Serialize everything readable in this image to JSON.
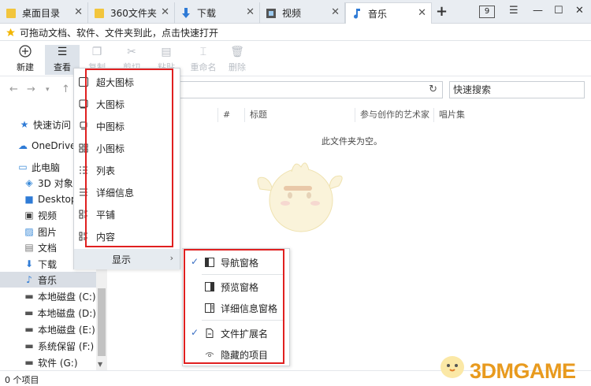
{
  "tabs": [
    {
      "label": "桌面目录",
      "icon": "folder-icon",
      "active": false
    },
    {
      "label": "360文件夹",
      "icon": "folder-icon",
      "active": false
    },
    {
      "label": "下载",
      "icon": "download-arrow-icon",
      "active": false
    },
    {
      "label": "视频",
      "icon": "video-icon",
      "active": false
    },
    {
      "label": "音乐",
      "icon": "music-note-icon",
      "active": true
    }
  ],
  "tab_count": "9",
  "hint": {
    "text": "可拖动文档、软件、文件夹到此，点击快速打开",
    "icon": "star-icon"
  },
  "toolbar": {
    "new_label": "新建",
    "view_label": "查看",
    "copy_label": "复制",
    "cut_label": "剪切",
    "paste_label": "粘贴",
    "rename_label": "重命名",
    "delete_label": "删除"
  },
  "search": {
    "placeholder": "快速搜索"
  },
  "sidebar": {
    "items": [
      {
        "label": "快速访问",
        "icon": "star-icon"
      },
      {
        "label": "OneDrive",
        "icon": "cloud-icon"
      },
      {
        "label": "此电脑",
        "icon": "computer-icon"
      },
      {
        "label": "3D 对象",
        "icon": "cube-icon"
      },
      {
        "label": "Desktop",
        "icon": "desktop-icon"
      },
      {
        "label": "视频",
        "icon": "video-icon"
      },
      {
        "label": "图片",
        "icon": "picture-icon"
      },
      {
        "label": "文档",
        "icon": "document-icon"
      },
      {
        "label": "下载",
        "icon": "download-arrow-icon"
      },
      {
        "label": "音乐",
        "icon": "music-note-icon"
      },
      {
        "label": "本地磁盘 (C:)",
        "icon": "drive-icon"
      },
      {
        "label": "本地磁盘 (D:)",
        "icon": "drive-icon"
      },
      {
        "label": "本地磁盘 (E:)",
        "icon": "drive-icon"
      },
      {
        "label": "系统保留 (F:)",
        "icon": "drive-icon"
      },
      {
        "label": "软件 (G:)",
        "icon": "drive-icon"
      }
    ],
    "selected": "音乐"
  },
  "columns": {
    "num": "#",
    "title": "标题",
    "artist": "参与创作的艺术家",
    "album": "唱片集"
  },
  "empty_message": "此文件夹为空。",
  "status": {
    "count": "0 个项目"
  },
  "watermark": "3DMGAME",
  "view_menu": {
    "items": [
      {
        "label": "超大图标",
        "icon": "extra-large-icons-icon"
      },
      {
        "label": "大图标",
        "icon": "large-icons-icon"
      },
      {
        "label": "中图标",
        "icon": "medium-icons-icon"
      },
      {
        "label": "小图标",
        "icon": "small-icons-icon"
      },
      {
        "label": "列表",
        "icon": "list-view-icon"
      },
      {
        "label": "详细信息",
        "icon": "details-view-icon"
      },
      {
        "label": "平铺",
        "icon": "tiles-view-icon"
      },
      {
        "label": "内容",
        "icon": "content-view-icon"
      }
    ],
    "display_label": "显示"
  },
  "display_submenu": {
    "items": [
      {
        "label": "导航窗格",
        "checked": true,
        "icon": "navigation-pane-icon"
      },
      {
        "label": "预览窗格",
        "checked": false,
        "icon": "preview-pane-icon"
      },
      {
        "label": "详细信息窗格",
        "checked": false,
        "icon": "details-pane-icon"
      },
      {
        "label": "文件扩展名",
        "checked": true,
        "icon": "file-extension-icon"
      },
      {
        "label": "隐藏的项目",
        "checked": false,
        "icon": "eye-icon"
      }
    ]
  },
  "colors": {
    "highlight_border": "#e02020",
    "accent": "#3a6fc4",
    "watermark": "#e89a1e"
  }
}
